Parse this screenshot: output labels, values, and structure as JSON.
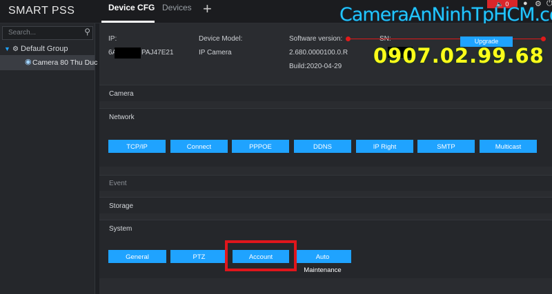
{
  "header": {
    "logo": "SMART PSS",
    "tabs": [
      {
        "label": "Device CFG",
        "active": true
      },
      {
        "label": "Devices",
        "active": false
      }
    ],
    "add_tab_glyph": "+",
    "alarm_count": "0",
    "icons": [
      "speaker-icon",
      "user-icon",
      "gear-icon",
      "power-icon"
    ]
  },
  "watermark": {
    "site": "CameraAnNinhTpHCM.com",
    "phone": "0907.02.99.68"
  },
  "sidebar": {
    "search_placeholder": "Search...",
    "group_label": "Default Group",
    "device_label": "Camera 80 Thu Duc"
  },
  "device_info": {
    "ip_label": "IP:",
    "ip_value": "PAJ47E21",
    "ip_prefix": "6A",
    "model_label": "Device Model:",
    "model_value": "IP Camera",
    "software_label": "Software version:",
    "software_value": "2.680.0000100.0.R",
    "build_value": "Build:2020-04-29",
    "sn_label": "SN:",
    "upgrade_label": "Upgrade"
  },
  "sections": {
    "camera": "Camera",
    "network": "Network",
    "event": "Event",
    "storage": "Storage",
    "system": "System"
  },
  "network_buttons": [
    "TCP/IP",
    "Connect",
    "PPPOE",
    "DDNS",
    "IP Right",
    "SMTP",
    "Multicast"
  ],
  "system_buttons": [
    "General",
    "PTZ",
    "Account",
    "Auto Maintenance"
  ],
  "colors": {
    "accent": "#1fa3ff",
    "highlight": "#e0161c",
    "watermark_site": "#22c7ff",
    "watermark_phone": "#ffff1a"
  }
}
